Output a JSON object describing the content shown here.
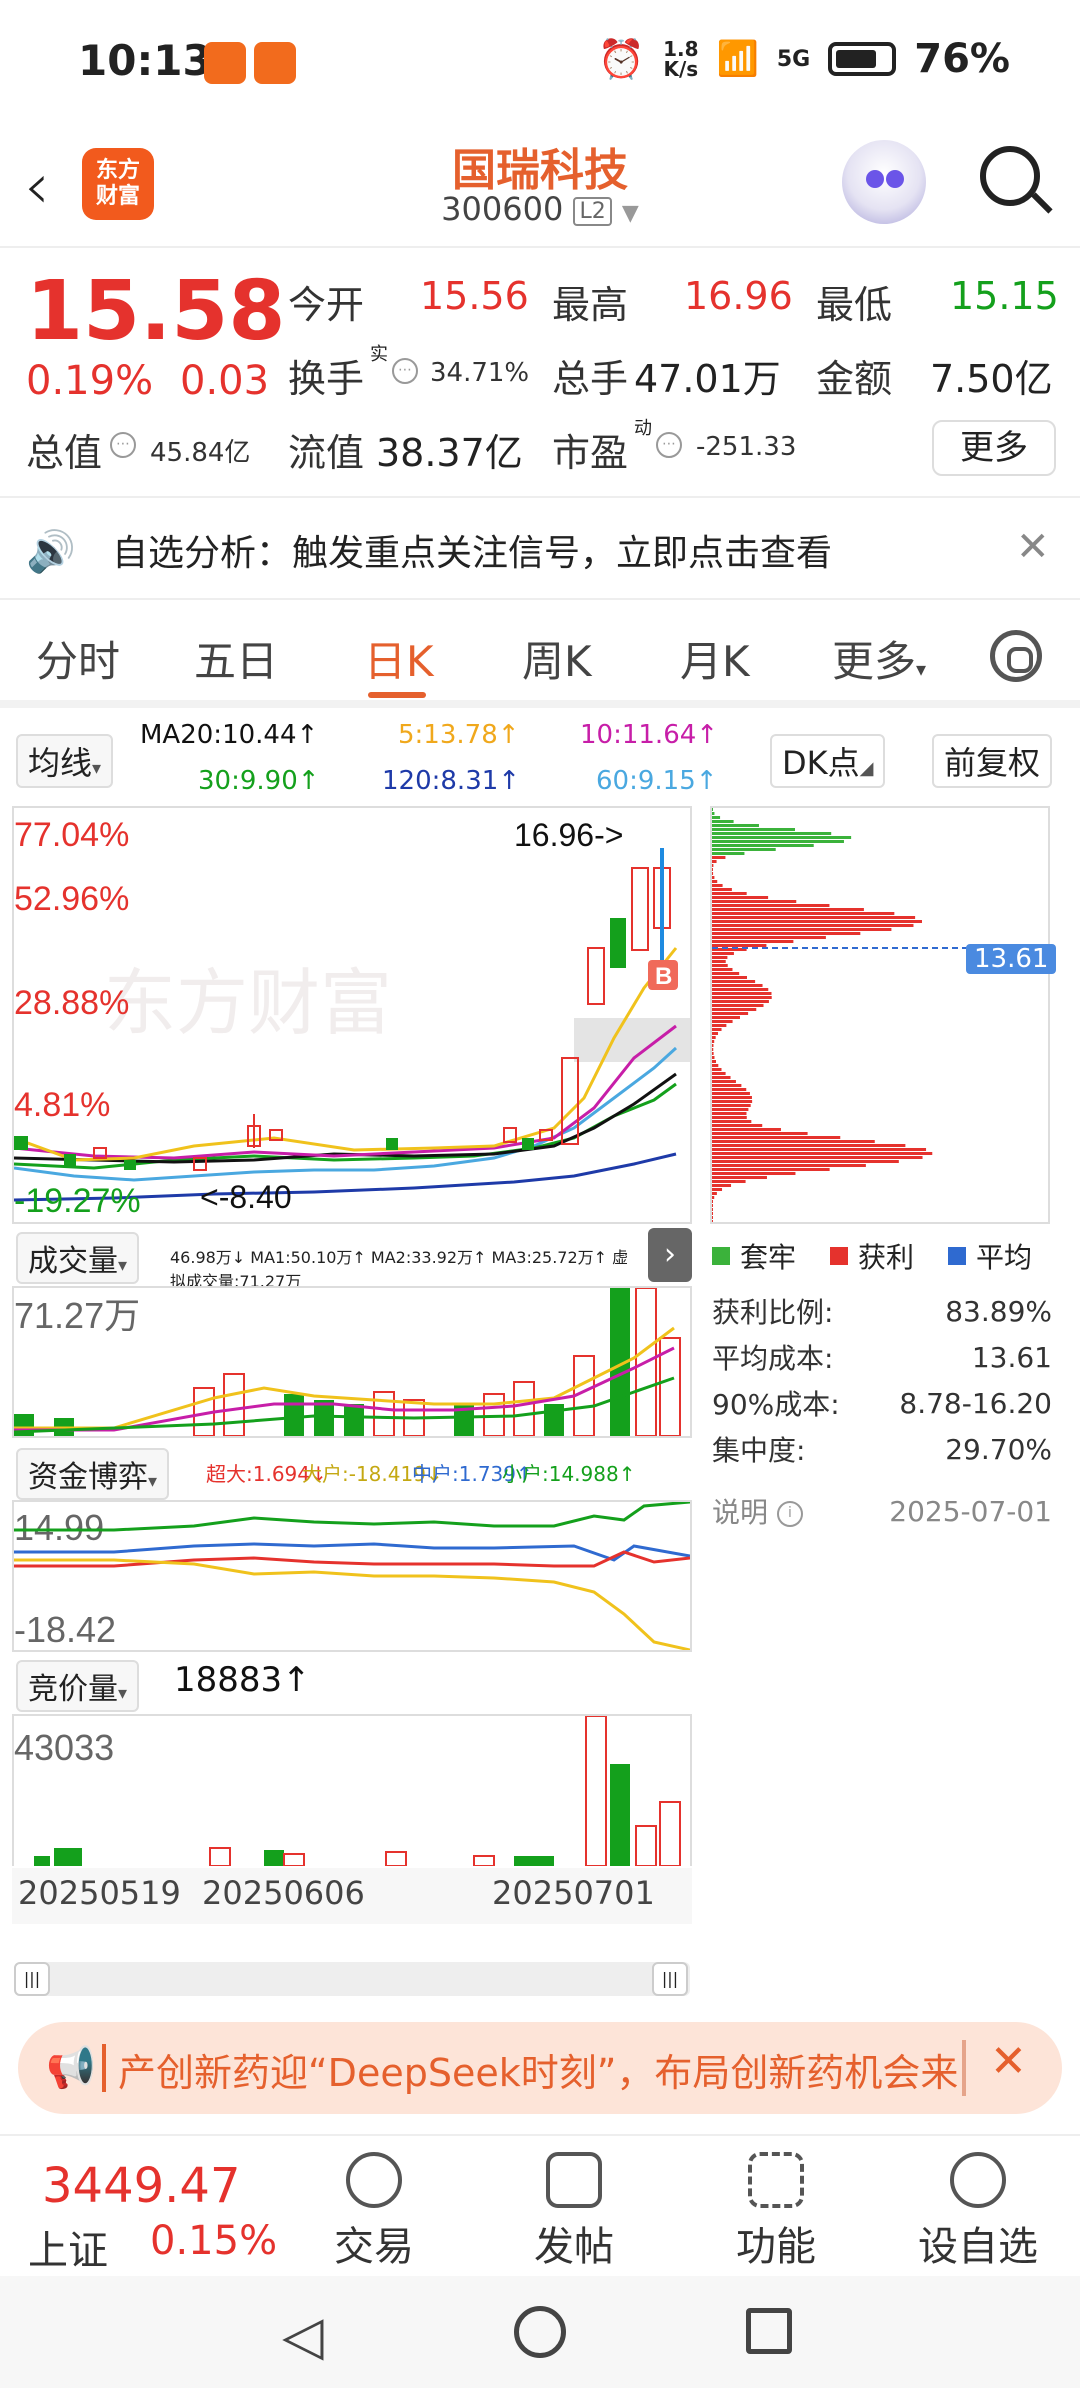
{
  "status_bar": {
    "time": "10:13",
    "net_speed_value": "1.8",
    "net_speed_unit": "K/s",
    "network": "5G",
    "battery": "76%"
  },
  "header": {
    "brand_line1": "东方",
    "brand_line2": "财富",
    "stock_name": "国瑞科技",
    "stock_code": "300600",
    "level_badge": "L2"
  },
  "quote": {
    "price": "15.58",
    "change_pct": "0.19%",
    "change": "0.03",
    "open_label": "今开",
    "open": "15.56",
    "high_label": "最高",
    "high": "16.96",
    "low_label": "最低",
    "low": "15.15",
    "turnover_label": "换手",
    "turnover_sup": "实",
    "turnover": "34.71%",
    "volume_label": "总手",
    "volume": "47.01万",
    "amount_label": "金额",
    "amount": "7.50亿",
    "mktcap_label": "总值",
    "mktcap": "45.84亿",
    "float_label": "流值",
    "float": "38.37亿",
    "pe_label": "市盈",
    "pe_sup": "动",
    "pe": "-251.33",
    "more": "更多"
  },
  "alert": {
    "text": "自选分析：触发重点关注信号，立即点击查看"
  },
  "tabs": [
    "分时",
    "五日",
    "日K",
    "周K",
    "月K",
    "更多"
  ],
  "ma_row": {
    "selector": "均线",
    "ma20": "MA20:10.44↑",
    "ma5": "5:13.78↑",
    "ma10": "10:11.64↑",
    "ma30": "30:9.90↑",
    "ma120": "120:8.31↑",
    "ma60": "60:9.15↑",
    "dk": "DK点",
    "adjust": "前复权"
  },
  "kline": {
    "label_top": "77.04%",
    "label_2": "52.96%",
    "label_3": "28.88%",
    "label_4": "4.81%",
    "label_low": "-19.27%",
    "high_marker": "16.96->",
    "low_marker": "<-8.40",
    "signal": "B",
    "watermark": "东方财富"
  },
  "volume_panel": {
    "selector": "成交量",
    "info": "46.98万↓ MA1:50.10万↑ MA2:33.92万↑ MA3:25.72万↑ 虚拟成交量:71.27万",
    "max": "71.27万"
  },
  "fund_panel": {
    "selector": "资金博弈",
    "super": "超大:1.694↓",
    "large": "大户:-18.419↓",
    "mid": "中户:1.739↑",
    "small": "小户:14.988↑",
    "top": "14.99",
    "bottom": "-18.42"
  },
  "auction_panel": {
    "selector": "竞价量",
    "value": "18883↑",
    "max": "43033"
  },
  "dates": [
    "20250519",
    "20250606",
    "20250701"
  ],
  "chip_dist": {
    "avg_price_label": "13.61",
    "legend": [
      "套牢",
      "获利",
      "平均"
    ],
    "rows": [
      {
        "label": "获利比例:",
        "value": "83.89%"
      },
      {
        "label": "平均成本:",
        "value": "13.61"
      },
      {
        "label": "90%成本:",
        "value": "8.78-16.20"
      },
      {
        "label": "集中度:",
        "value": "29.70%"
      }
    ],
    "note": "说明",
    "date": "2025-07-01"
  },
  "marquee": {
    "text": "产创新药迎“DeepSeek时刻”，布局创新药机会来"
  },
  "bottom": {
    "index_value": "3449.47",
    "index_name": "上证",
    "index_pct": "0.15%",
    "items": [
      "交易",
      "发帖",
      "功能",
      "设自选"
    ]
  },
  "colors": {
    "up": "#e5322d",
    "down": "#14a01c",
    "accent": "#e5602d"
  }
}
